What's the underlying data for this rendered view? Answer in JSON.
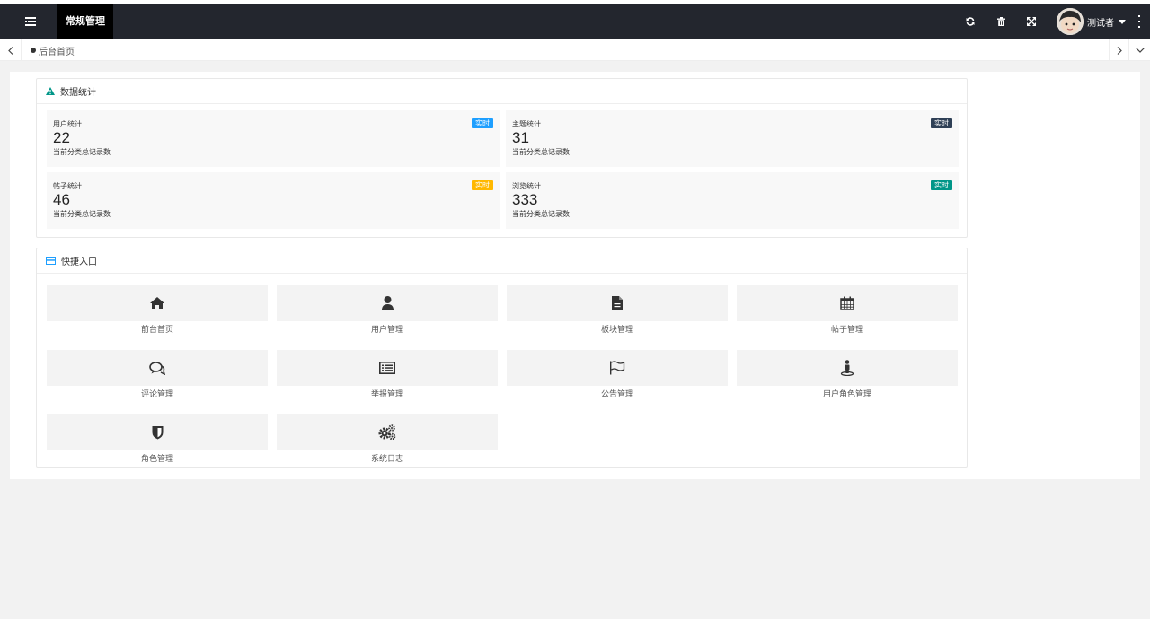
{
  "header": {
    "active_tab": "常规管理",
    "user_name": "测试者",
    "icons": [
      "menu-icon",
      "refresh-icon",
      "trash-icon",
      "fullscreen-icon",
      "more-icon"
    ]
  },
  "tabs": {
    "home_label": "后台首页"
  },
  "stats_card": {
    "title": "数据统计",
    "items": [
      {
        "label": "用户统计",
        "value": "22",
        "sub": "当前分类总记录数",
        "badge": "实时",
        "badge_color": "#1e9fff"
      },
      {
        "label": "主题统计",
        "value": "31",
        "sub": "当前分类总记录数",
        "badge": "实时",
        "badge_color": "#2f4056"
      },
      {
        "label": "帖子统计",
        "value": "46",
        "sub": "当前分类总记录数",
        "badge": "实时",
        "badge_color": "#ffb800"
      },
      {
        "label": "浏览统计",
        "value": "333",
        "sub": "当前分类总记录数",
        "badge": "实时",
        "badge_color": "#009688"
      }
    ]
  },
  "quick_card": {
    "title": "快捷入口",
    "items": [
      {
        "label": "前台首页",
        "icon": "home-icon"
      },
      {
        "label": "用户管理",
        "icon": "user-icon"
      },
      {
        "label": "板块管理",
        "icon": "document-icon"
      },
      {
        "label": "帖子管理",
        "icon": "calendar-icon"
      },
      {
        "label": "评论管理",
        "icon": "comments-icon"
      },
      {
        "label": "举报管理",
        "icon": "list-icon"
      },
      {
        "label": "公告管理",
        "icon": "flag-icon"
      },
      {
        "label": "用户角色管理",
        "icon": "user-pin-icon"
      },
      {
        "label": "角色管理",
        "icon": "shield-icon"
      },
      {
        "label": "系统日志",
        "icon": "gears-icon"
      }
    ]
  },
  "colors": {
    "topbar": "#23262e",
    "active_tab": "#000000",
    "warning_icon": "#009688",
    "card_icon": "#1e9fff"
  }
}
